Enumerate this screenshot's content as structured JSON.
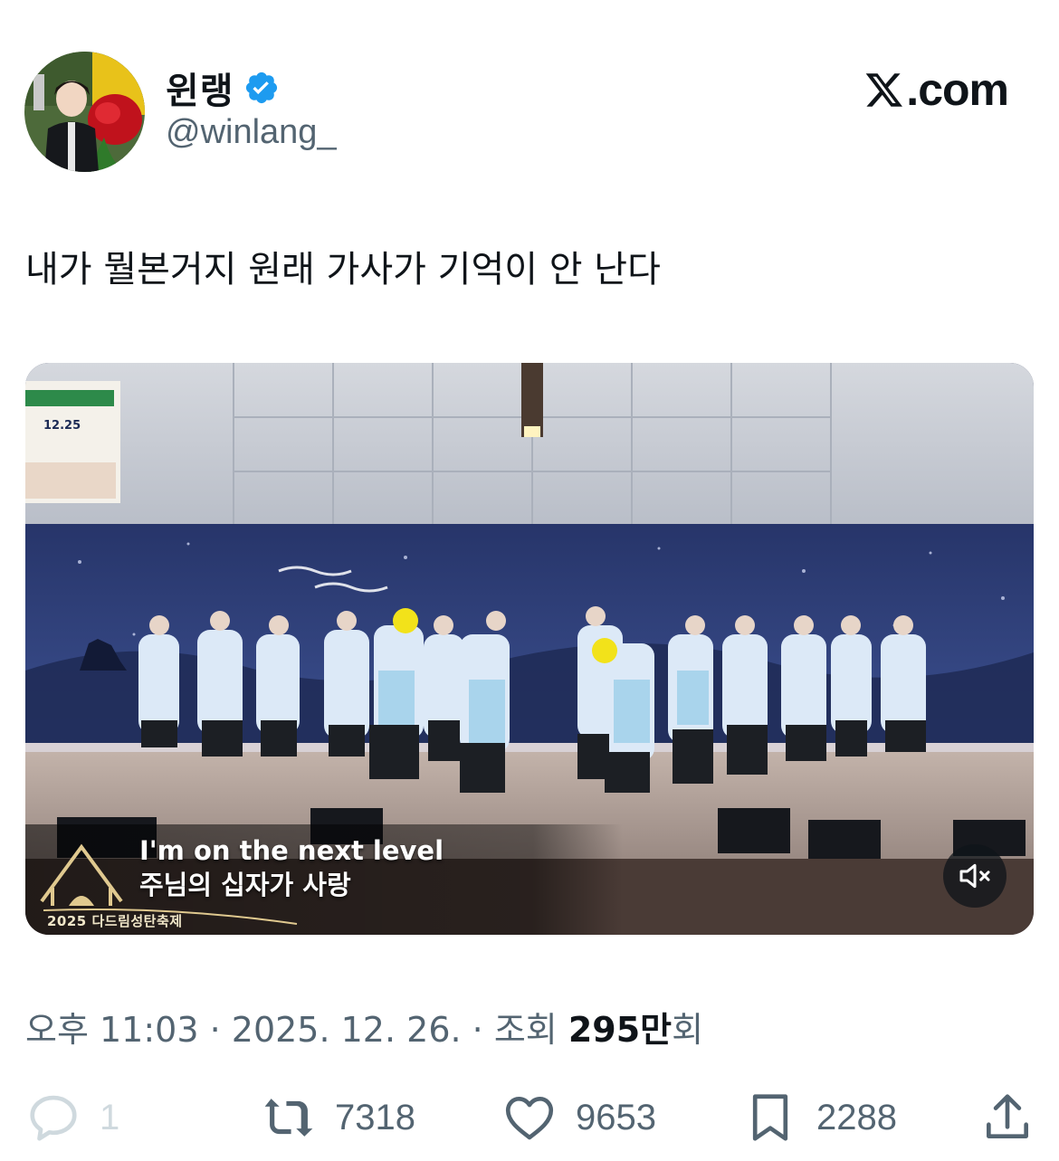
{
  "author": {
    "display_name": "윈랭",
    "handle": "@winlang_",
    "verified": true,
    "avatar_icon": "avatar-photo"
  },
  "brand": {
    "label": ".com",
    "icon": "x-logo-icon"
  },
  "tweet": {
    "text": "내가 뭘본거지 원래 가사가 기억이 안 난다"
  },
  "video": {
    "subtitle_line1": "I'm on the next level",
    "subtitle_line2": "주님의 십자가 사랑",
    "festival_label": "2025 다드림성탄축제",
    "banner_date": "12.25",
    "mute_icon": "volume-muted-icon"
  },
  "meta": {
    "time": "오후 11:03",
    "sep1": " · ",
    "date": "2025. 12. 26.",
    "sep2": " · ",
    "views_prefix": "조회 ",
    "views_count": "295만",
    "views_suffix": "회"
  },
  "actions": {
    "reply": {
      "icon": "reply-icon",
      "count": "1"
    },
    "repost": {
      "icon": "repost-icon",
      "count": "7318"
    },
    "like": {
      "icon": "heart-icon",
      "count": "9653"
    },
    "bookmark": {
      "icon": "bookmark-icon",
      "count": "2288"
    },
    "share": {
      "icon": "share-icon"
    }
  },
  "colors": {
    "verified_blue": "#1d9bf0",
    "text_primary": "#0f1419",
    "text_secondary": "#536471"
  }
}
